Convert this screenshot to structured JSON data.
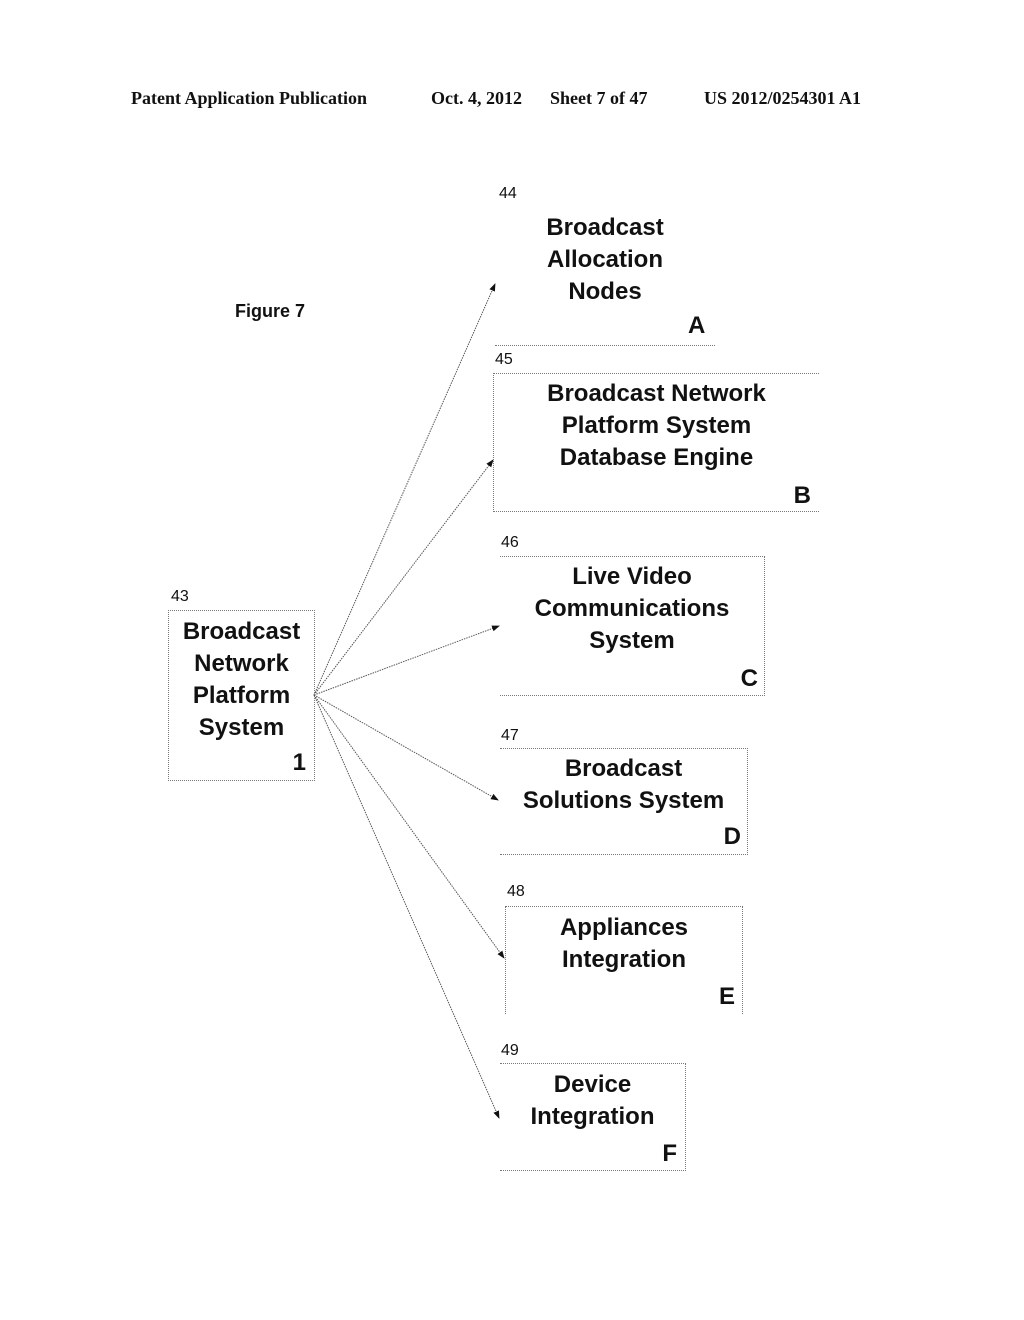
{
  "header": {
    "publication": "Patent Application Publication",
    "date": "Oct. 4, 2012",
    "sheet": "Sheet 7 of 47",
    "patent_number": "US 2012/0254301 A1"
  },
  "figure_label": "Figure 7",
  "source_node": {
    "ref": "43",
    "title": "Broadcast\nNetwork\nPlatform\nSystem",
    "letter": "1"
  },
  "target_nodes": [
    {
      "ref": "44",
      "title": "Broadcast\nAllocation\nNodes",
      "letter": "A"
    },
    {
      "ref": "45",
      "title": "Broadcast Network\nPlatform System\nDatabase Engine",
      "letter": "B"
    },
    {
      "ref": "46",
      "title": "Live Video\nCommunications\nSystem",
      "letter": "C"
    },
    {
      "ref": "47",
      "title": "Broadcast\nSolutions System",
      "letter": "D"
    },
    {
      "ref": "48",
      "title": "Appliances\nIntegration",
      "letter": "E"
    },
    {
      "ref": "49",
      "title": "Device\nIntegration",
      "letter": "F"
    }
  ],
  "edges": [
    {
      "from": "1",
      "to": "A"
    },
    {
      "from": "1",
      "to": "B"
    },
    {
      "from": "1",
      "to": "C"
    },
    {
      "from": "1",
      "to": "D"
    },
    {
      "from": "1",
      "to": "E"
    },
    {
      "from": "1",
      "to": "F"
    }
  ]
}
